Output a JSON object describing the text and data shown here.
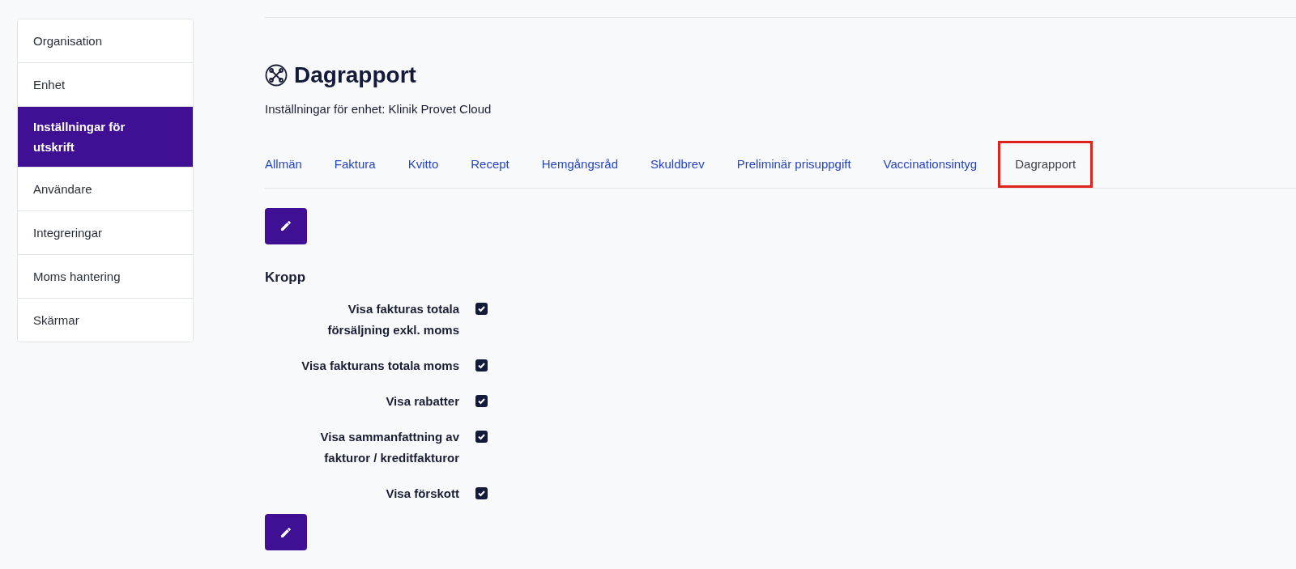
{
  "sidebar": {
    "items": [
      {
        "label": "Organisation",
        "selected": false
      },
      {
        "label": "Enhet",
        "selected": false
      },
      {
        "label": "Inställningar för utskrift",
        "selected": true
      },
      {
        "label": "Användare",
        "selected": false
      },
      {
        "label": "Integreringar",
        "selected": false
      },
      {
        "label": "Moms hantering",
        "selected": false
      },
      {
        "label": "Skärmar",
        "selected": false
      }
    ]
  },
  "page": {
    "title": "Dagrapport",
    "subtitle": "Inställningar för enhet: Klinik Provet Cloud"
  },
  "tabs": [
    {
      "label": "Allmän",
      "selected": false
    },
    {
      "label": "Faktura",
      "selected": false
    },
    {
      "label": "Kvitto",
      "selected": false
    },
    {
      "label": "Recept",
      "selected": false
    },
    {
      "label": "Hemgångsråd",
      "selected": false
    },
    {
      "label": "Skuldbrev",
      "selected": false
    },
    {
      "label": "Preliminär prisuppgift",
      "selected": false
    },
    {
      "label": "Vaccinationsintyg",
      "selected": false
    },
    {
      "label": "Dagrapport",
      "selected": true
    }
  ],
  "section": {
    "heading": "Kropp",
    "options": [
      {
        "label": "Visa fakturas totala försäljning exkl. moms",
        "checked": true
      },
      {
        "label": "Visa fakturans totala moms",
        "checked": true
      },
      {
        "label": "Visa rabatter",
        "checked": true
      },
      {
        "label": "Visa sammanfattning av fakturor / kreditfakturor",
        "checked": true
      },
      {
        "label": "Visa förskott",
        "checked": true
      }
    ]
  }
}
